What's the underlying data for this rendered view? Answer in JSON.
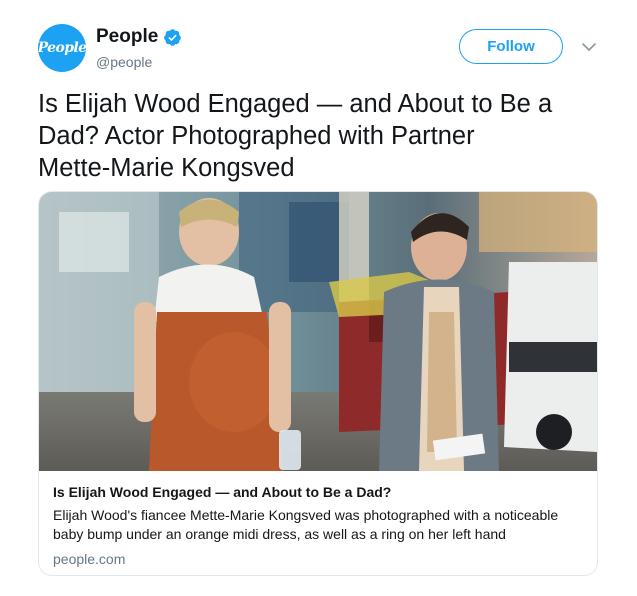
{
  "tweet": {
    "author": {
      "display_name": "People",
      "handle": "@people",
      "avatar_text": "People",
      "verified": true,
      "avatar_color": "#1da1f2"
    },
    "follow_label": "Follow",
    "menu_icon": "chevron-down-icon",
    "text_lines": [
      "Is Elijah Wood Engaged — and About to Be a",
      "Dad? Actor Photographed with Partner",
      "Mette-Marie Kongsved"
    ]
  },
  "card": {
    "image_alt": "photo of a woman in an orange midi dress and a man in a grey cardigan walking in a parking lot",
    "title": "Is Elijah Wood Engaged — and About to Be a Dad?",
    "description_lines": [
      "Elijah Wood's fiancee Mette-Marie Kongsved was photographed with a noticeable",
      "baby bump under an orange midi dress, as well as a ring on her left hand"
    ],
    "domain": "people.com"
  },
  "colors": {
    "accent": "#1da1f2",
    "text": "#14171a",
    "secondary_text": "#657786",
    "border": "#e1e8ed"
  }
}
